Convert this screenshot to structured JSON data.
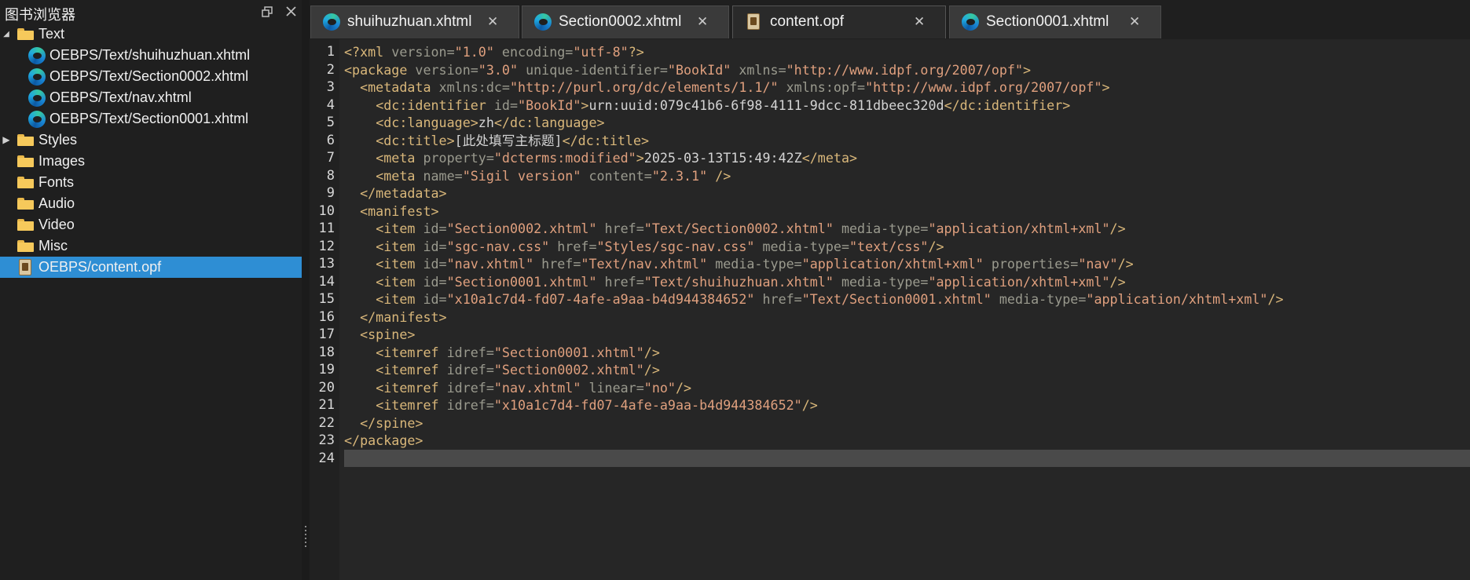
{
  "panel": {
    "title": "图书浏览器",
    "float_icon": "restore-icon",
    "close_icon": "close-icon"
  },
  "tree": [
    {
      "label": "Text",
      "type": "folder",
      "expanded": true,
      "level": 0
    },
    {
      "label": "OEBPS/Text/shuihuzhuan.xhtml",
      "type": "xhtml",
      "level": 1
    },
    {
      "label": "OEBPS/Text/Section0002.xhtml",
      "type": "xhtml",
      "level": 1
    },
    {
      "label": "OEBPS/Text/nav.xhtml",
      "type": "xhtml",
      "level": 1
    },
    {
      "label": "OEBPS/Text/Section0001.xhtml",
      "type": "xhtml",
      "level": 1
    },
    {
      "label": "Styles",
      "type": "folder",
      "collapsed": true,
      "level": 0
    },
    {
      "label": "Images",
      "type": "folder",
      "level": 0
    },
    {
      "label": "Fonts",
      "type": "folder",
      "level": 0
    },
    {
      "label": "Audio",
      "type": "folder",
      "level": 0
    },
    {
      "label": "Video",
      "type": "folder",
      "level": 0
    },
    {
      "label": "Misc",
      "type": "folder",
      "level": 0
    },
    {
      "label": "OEBPS/content.opf",
      "type": "opf",
      "level": 0,
      "selected": true
    }
  ],
  "tabs": [
    {
      "label": "shuihuzhuan.xhtml",
      "icon": "edge-icon",
      "active": false
    },
    {
      "label": "Section0002.xhtml",
      "icon": "edge-icon",
      "active": false
    },
    {
      "label": "content.opf",
      "icon": "opf-icon",
      "active": true
    },
    {
      "label": "Section0001.xhtml",
      "icon": "edge-icon",
      "active": false
    }
  ],
  "tab_close_glyph": "✕",
  "editor": {
    "current_line": 24,
    "lines": [
      [
        [
          "tag",
          "<?xml "
        ],
        [
          "attr",
          "version="
        ],
        [
          "val",
          "\"1.0\""
        ],
        [
          "attr",
          " encoding="
        ],
        [
          "val",
          "\"utf-8\""
        ],
        [
          "tag",
          "?>"
        ]
      ],
      [
        [
          "tag",
          "<package "
        ],
        [
          "attr",
          "version="
        ],
        [
          "val",
          "\"3.0\""
        ],
        [
          "attr",
          " unique-identifier="
        ],
        [
          "val",
          "\"BookId\""
        ],
        [
          "attr",
          " xmlns="
        ],
        [
          "val",
          "\"http://www.idpf.org/2007/opf\""
        ],
        [
          "tag",
          ">"
        ]
      ],
      [
        [
          "text",
          "  "
        ],
        [
          "tag",
          "<metadata "
        ],
        [
          "attr",
          "xmlns:dc="
        ],
        [
          "val",
          "\"http://purl.org/dc/elements/1.1/\""
        ],
        [
          "attr",
          " xmlns:opf="
        ],
        [
          "val",
          "\"http://www.idpf.org/2007/opf\""
        ],
        [
          "tag",
          ">"
        ]
      ],
      [
        [
          "text",
          "    "
        ],
        [
          "tag",
          "<dc:identifier "
        ],
        [
          "attr",
          "id="
        ],
        [
          "val",
          "\"BookId\""
        ],
        [
          "tag",
          ">"
        ],
        [
          "text",
          "urn:uuid:079c41b6-6f98-4111-9dcc-811dbeec320d"
        ],
        [
          "tag",
          "</dc:identifier>"
        ]
      ],
      [
        [
          "text",
          "    "
        ],
        [
          "tag",
          "<dc:language>"
        ],
        [
          "text",
          "zh"
        ],
        [
          "tag",
          "</dc:language>"
        ]
      ],
      [
        [
          "text",
          "    "
        ],
        [
          "tag",
          "<dc:title>"
        ],
        [
          "text",
          "[此处填写主标题]"
        ],
        [
          "tag",
          "</dc:title>"
        ]
      ],
      [
        [
          "text",
          "    "
        ],
        [
          "tag",
          "<meta "
        ],
        [
          "attr",
          "property="
        ],
        [
          "val",
          "\"dcterms:modified\""
        ],
        [
          "tag",
          ">"
        ],
        [
          "text",
          "2025-03-13T15:49:42Z"
        ],
        [
          "tag",
          "</meta>"
        ]
      ],
      [
        [
          "text",
          "    "
        ],
        [
          "tag",
          "<meta "
        ],
        [
          "attr",
          "name="
        ],
        [
          "val",
          "\"Sigil version\""
        ],
        [
          "attr",
          " content="
        ],
        [
          "val",
          "\"2.3.1\""
        ],
        [
          "tag",
          " />"
        ]
      ],
      [
        [
          "text",
          "  "
        ],
        [
          "tag",
          "</metadata>"
        ]
      ],
      [
        [
          "text",
          "  "
        ],
        [
          "tag",
          "<manifest>"
        ]
      ],
      [
        [
          "text",
          "    "
        ],
        [
          "tag",
          "<item "
        ],
        [
          "attr",
          "id="
        ],
        [
          "val",
          "\"Section0002.xhtml\""
        ],
        [
          "attr",
          " href="
        ],
        [
          "val",
          "\"Text/Section0002.xhtml\""
        ],
        [
          "attr",
          " media-type="
        ],
        [
          "val",
          "\"application/xhtml+xml\""
        ],
        [
          "tag",
          "/>"
        ]
      ],
      [
        [
          "text",
          "    "
        ],
        [
          "tag",
          "<item "
        ],
        [
          "attr",
          "id="
        ],
        [
          "val",
          "\"sgc-nav.css\""
        ],
        [
          "attr",
          " href="
        ],
        [
          "val",
          "\"Styles/sgc-nav.css\""
        ],
        [
          "attr",
          " media-type="
        ],
        [
          "val",
          "\"text/css\""
        ],
        [
          "tag",
          "/>"
        ]
      ],
      [
        [
          "text",
          "    "
        ],
        [
          "tag",
          "<item "
        ],
        [
          "attr",
          "id="
        ],
        [
          "val",
          "\"nav.xhtml\""
        ],
        [
          "attr",
          " href="
        ],
        [
          "val",
          "\"Text/nav.xhtml\""
        ],
        [
          "attr",
          " media-type="
        ],
        [
          "val",
          "\"application/xhtml+xml\""
        ],
        [
          "attr",
          " properties="
        ],
        [
          "val",
          "\"nav\""
        ],
        [
          "tag",
          "/>"
        ]
      ],
      [
        [
          "text",
          "    "
        ],
        [
          "tag",
          "<item "
        ],
        [
          "attr",
          "id="
        ],
        [
          "val",
          "\"Section0001.xhtml\""
        ],
        [
          "attr",
          " href="
        ],
        [
          "val",
          "\"Text/shuihuzhuan.xhtml\""
        ],
        [
          "attr",
          " media-type="
        ],
        [
          "val",
          "\"application/xhtml+xml\""
        ],
        [
          "tag",
          "/>"
        ]
      ],
      [
        [
          "text",
          "    "
        ],
        [
          "tag",
          "<item "
        ],
        [
          "attr",
          "id="
        ],
        [
          "val",
          "\"x10a1c7d4-fd07-4afe-a9aa-b4d944384652\""
        ],
        [
          "attr",
          " href="
        ],
        [
          "val",
          "\"Text/Section0001.xhtml\""
        ],
        [
          "attr",
          " media-type="
        ],
        [
          "val",
          "\"application/xhtml+xml\""
        ],
        [
          "tag",
          "/>"
        ]
      ],
      [
        [
          "text",
          "  "
        ],
        [
          "tag",
          "</manifest>"
        ]
      ],
      [
        [
          "text",
          "  "
        ],
        [
          "tag",
          "<spine>"
        ]
      ],
      [
        [
          "text",
          "    "
        ],
        [
          "tag",
          "<itemref "
        ],
        [
          "attr",
          "idref="
        ],
        [
          "val",
          "\"Section0001.xhtml\""
        ],
        [
          "tag",
          "/>"
        ]
      ],
      [
        [
          "text",
          "    "
        ],
        [
          "tag",
          "<itemref "
        ],
        [
          "attr",
          "idref="
        ],
        [
          "val",
          "\"Section0002.xhtml\""
        ],
        [
          "tag",
          "/>"
        ]
      ],
      [
        [
          "text",
          "    "
        ],
        [
          "tag",
          "<itemref "
        ],
        [
          "attr",
          "idref="
        ],
        [
          "val",
          "\"nav.xhtml\""
        ],
        [
          "attr",
          " linear="
        ],
        [
          "val",
          "\"no\""
        ],
        [
          "tag",
          "/>"
        ]
      ],
      [
        [
          "text",
          "    "
        ],
        [
          "tag",
          "<itemref "
        ],
        [
          "attr",
          "idref="
        ],
        [
          "val",
          "\"x10a1c7d4-fd07-4afe-a9aa-b4d944384652\""
        ],
        [
          "tag",
          "/>"
        ]
      ],
      [
        [
          "text",
          "  "
        ],
        [
          "tag",
          "</spine>"
        ]
      ],
      [
        [
          "tag",
          "</package>"
        ]
      ],
      []
    ]
  }
}
